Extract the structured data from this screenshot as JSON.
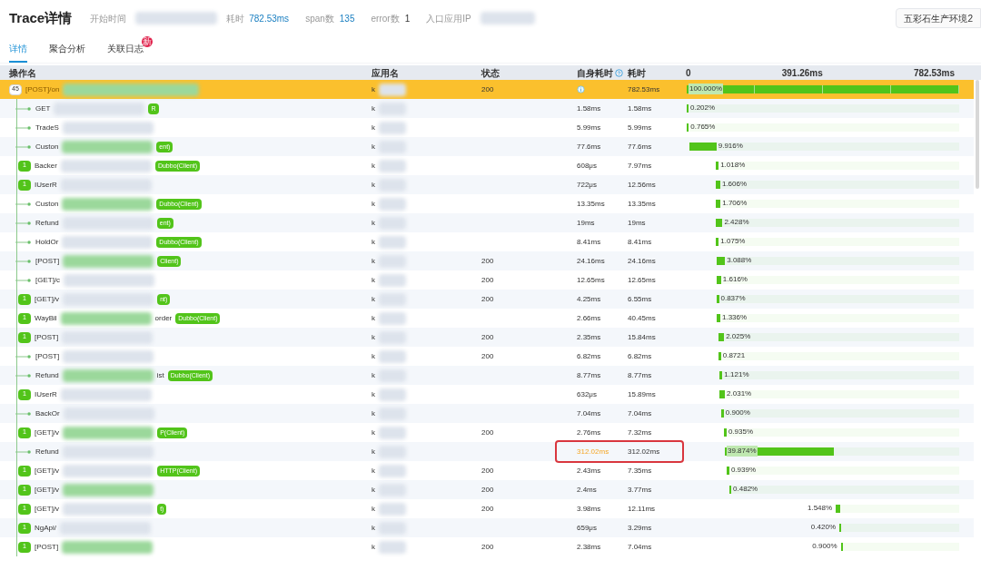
{
  "header": {
    "title": "Trace详情",
    "start_label": "开始时间",
    "duration_label": "耗时",
    "duration": "782.53ms",
    "span_label": "span数",
    "span_count": "135",
    "error_label": "error数",
    "error_count": "1",
    "ip_label": "入口应用IP",
    "env_button": "五彩石生产环境2"
  },
  "tabs": [
    {
      "label": "详情",
      "selected": true
    },
    {
      "label": "聚合分析",
      "selected": false
    },
    {
      "label": "关联日志",
      "selected": false,
      "badge": "新"
    }
  ],
  "table": {
    "columns": [
      "操作名",
      "应用名",
      "状态",
      "自身耗时",
      "耗时"
    ],
    "timeline_ticks": [
      "0",
      "391.26ms",
      "782.53ms"
    ],
    "rows": [
      {
        "kind": "root",
        "count": "45",
        "name": "[POST]/on",
        "app": "k",
        "status": "200",
        "total": "782.53ms",
        "pct": "100.000%",
        "level": 1,
        "label_left": false,
        "selected": true,
        "slow": false
      },
      {
        "kind": "leaf",
        "name": "GET",
        "tag": "R",
        "app": "k",
        "self": "1.58ms",
        "total": "1.58ms",
        "pct": "0.202%",
        "level": 0.00202,
        "label_left": false,
        "selected": false,
        "slow": false
      },
      {
        "kind": "leaf",
        "name": "TradeS",
        "app": "k",
        "self": "5.99ms",
        "total": "5.99ms",
        "pct": "0.765%",
        "level": 0.00765,
        "label_left": false,
        "selected": false,
        "slow": false
      },
      {
        "kind": "leaf",
        "name": "Custon",
        "tag": "ent)",
        "app": "k",
        "self": "77.6ms",
        "total": "77.6ms",
        "pct": "9.916%",
        "level": 0.09916,
        "label_left": false,
        "selected": false,
        "slow": false
      },
      {
        "kind": "count",
        "count": "1",
        "name": "Backer",
        "tag": "Dubbo(Client)",
        "app": "k",
        "self": "608μs",
        "total": "7.97ms",
        "pct": "1.018%",
        "level": 0.01018,
        "label_left": false,
        "selected": false,
        "slow": false
      },
      {
        "kind": "count",
        "count": "1",
        "name": "IUserR",
        "app": "k",
        "self": "722μs",
        "total": "12.56ms",
        "pct": "1.606%",
        "level": 0.01606,
        "label_left": false,
        "selected": false,
        "slow": false
      },
      {
        "kind": "leaf",
        "name": "Custon",
        "tag": "Dubbo(Client)",
        "app": "k",
        "self": "13.35ms",
        "total": "13.35ms",
        "pct": "1.706%",
        "level": 0.01706,
        "label_left": false,
        "selected": false,
        "slow": false
      },
      {
        "kind": "leaf",
        "name": "Refund",
        "tag": "ent)",
        "app": "k",
        "self": "19ms",
        "total": "19ms",
        "pct": "2.428%",
        "level": 0.02428,
        "label_left": false,
        "selected": false,
        "slow": false
      },
      {
        "kind": "leaf",
        "name": "HoldOr",
        "tag": "Dubbo(Client)",
        "app": "k",
        "self": "8.41ms",
        "total": "8.41ms",
        "pct": "1.075%",
        "level": 0.01075,
        "label_left": false,
        "selected": false,
        "slow": false
      },
      {
        "kind": "leaf",
        "name": "[POST]",
        "tag": "Client)",
        "app": "k",
        "status": "200",
        "self": "24.16ms",
        "total": "24.16ms",
        "pct": "3.088%",
        "level": 0.03088,
        "label_left": false,
        "selected": false,
        "slow": false
      },
      {
        "kind": "leaf",
        "name": "[GET]/c",
        "app": "k",
        "status": "200",
        "self": "12.65ms",
        "total": "12.65ms",
        "pct": "1.616%",
        "level": 0.01616,
        "label_left": false,
        "selected": false,
        "slow": false
      },
      {
        "kind": "count",
        "count": "1",
        "name": "[GET]/v",
        "tag": "nt)",
        "app": "k",
        "status": "200",
        "self": "4.25ms",
        "total": "6.55ms",
        "pct": "0.837%",
        "level": 0.00837,
        "label_left": false,
        "selected": false,
        "slow": false
      },
      {
        "kind": "count",
        "count": "1",
        "name": "WayBil",
        "tag": "Dubbo(Client)",
        "suffix": "order",
        "app": "k",
        "self": "2.66ms",
        "total": "40.45ms",
        "pct": "1.336%",
        "level": 0.01336,
        "label_left": false,
        "selected": false,
        "slow": false
      },
      {
        "kind": "count",
        "count": "1",
        "name": "[POST]",
        "app": "k",
        "status": "200",
        "self": "2.35ms",
        "total": "15.84ms",
        "pct": "2.025%",
        "level": 0.02025,
        "label_left": false,
        "selected": false,
        "slow": false
      },
      {
        "kind": "leaf",
        "name": "[POST]",
        "app": "k",
        "status": "200",
        "self": "6.82ms",
        "total": "6.82ms",
        "pct": "0.8721",
        "level": 0.008721,
        "label_left": false,
        "selected": false,
        "slow": false
      },
      {
        "kind": "leaf",
        "name": "Refund",
        "tag": "Dubbo(Client)",
        "suffix": "ist",
        "app": "k",
        "self": "8.77ms",
        "total": "8.77ms",
        "pct": "1.121%",
        "level": 0.01121,
        "label_left": false,
        "selected": false,
        "slow": false
      },
      {
        "kind": "count",
        "count": "1",
        "name": "IUserR",
        "app": "k",
        "self": "632μs",
        "total": "15.89ms",
        "pct": "2.031%",
        "level": 0.02031,
        "label_left": false,
        "selected": false,
        "slow": false
      },
      {
        "kind": "leaf",
        "name": "BackOr",
        "app": "k",
        "self": "7.04ms",
        "total": "7.04ms",
        "pct": "0.900%",
        "level": 0.009,
        "label_left": false,
        "selected": false,
        "slow": false
      },
      {
        "kind": "count",
        "count": "1",
        "name": "[GET]/v",
        "tag": "P(Client)",
        "app": "k",
        "status": "200",
        "self": "2.76ms",
        "total": "7.32ms",
        "pct": "0.935%",
        "level": 0.00935,
        "label_left": false,
        "selected": false,
        "slow": false
      },
      {
        "kind": "leaf",
        "name": "Refund",
        "app": "k",
        "self": "312.02ms",
        "total": "312.02ms",
        "pct": "39.874%",
        "level": 0.39874,
        "label_left": false,
        "selected": false,
        "slow": true
      },
      {
        "kind": "count",
        "count": "1",
        "name": "[GET]/v",
        "tag": "HTTP(Client)",
        "app": "k",
        "status": "200",
        "self": "2.43ms",
        "total": "7.35ms",
        "pct": "0.939%",
        "level": 0.00939,
        "label_left": false,
        "selected": false,
        "slow": false
      },
      {
        "kind": "count",
        "count": "1",
        "name": "[GET]/v",
        "app": "k",
        "status": "200",
        "self": "2.4ms",
        "total": "3.77ms",
        "pct": "0.482%",
        "level": 0.00482,
        "label_left": false,
        "selected": false,
        "slow": false
      },
      {
        "kind": "count",
        "count": "1",
        "name": "[GET]/v",
        "tag": "t)",
        "app": "k",
        "status": "200",
        "self": "3.98ms",
        "total": "12.11ms",
        "pct": "1.548%",
        "level": 0.01548,
        "label_left": true,
        "selected": false,
        "slow": false
      },
      {
        "kind": "count",
        "count": "1",
        "name": "NgApi/",
        "app": "k",
        "self": "659μs",
        "total": "3.29ms",
        "pct": "0.420%",
        "level": 0.0042,
        "label_left": true,
        "selected": false,
        "slow": false
      },
      {
        "kind": "count",
        "count": "1",
        "name": "[POST]",
        "app": "k",
        "status": "200",
        "self": "2.38ms",
        "total": "7.04ms",
        "pct": "0.900%",
        "level": 0.009,
        "label_left": true,
        "selected": false,
        "slow": false
      }
    ]
  }
}
